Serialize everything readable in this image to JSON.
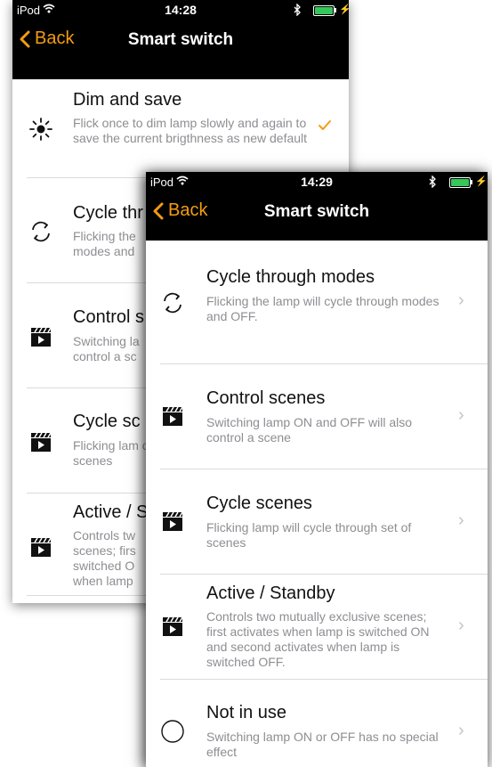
{
  "screen1": {
    "status": {
      "carrier": "iPod",
      "time": "14:28",
      "battery_color": "#34c759"
    },
    "nav": {
      "back_label": "Back",
      "title": "Smart switch"
    },
    "items": [
      {
        "icon": "sun-icon",
        "title": "Dim and save",
        "desc": "Flick once to dim lamp slowly and again to save the current brigthness as new default",
        "selected": true
      },
      {
        "icon": "cycle-arrows-icon",
        "title": "Cycle thr",
        "desc": "Flicking the modes and"
      },
      {
        "icon": "clapperboard-icon",
        "title": "Control s",
        "desc": "Switching la control a sc"
      },
      {
        "icon": "clapperboard-icon",
        "title": "Cycle sc",
        "desc": "Flicking lam of scenes"
      },
      {
        "icon": "clapperboard-icon",
        "title": "Active / S",
        "desc": "Controls tw scenes; firs switched O when lamp"
      }
    ]
  },
  "screen2": {
    "status": {
      "carrier": "iPod",
      "time": "14:29",
      "battery_color": "#34c759"
    },
    "nav": {
      "back_label": "Back",
      "title": "Smart switch"
    },
    "items": [
      {
        "icon": "cycle-arrows-icon",
        "title": "Cycle through modes",
        "desc": "Flicking the lamp will cycle through modes and OFF."
      },
      {
        "icon": "clapperboard-icon",
        "title": "Control scenes",
        "desc": "Switching lamp ON and OFF will also control a scene"
      },
      {
        "icon": "clapperboard-icon",
        "title": "Cycle scenes",
        "desc": "Flicking lamp will cycle through set of scenes"
      },
      {
        "icon": "clapperboard-icon",
        "title": "Active / Standby",
        "desc": "Controls two mutually exclusive scenes; first activates when lamp is switched ON and second activates when lamp is switched OFF."
      },
      {
        "icon": "empty-circle-icon",
        "title": "Not in use",
        "desc": "Switching lamp ON or OFF has no special effect"
      }
    ]
  },
  "colors": {
    "accent": "#f39c12",
    "nav_background": "#000000",
    "chevron": "#c4c4c8"
  }
}
